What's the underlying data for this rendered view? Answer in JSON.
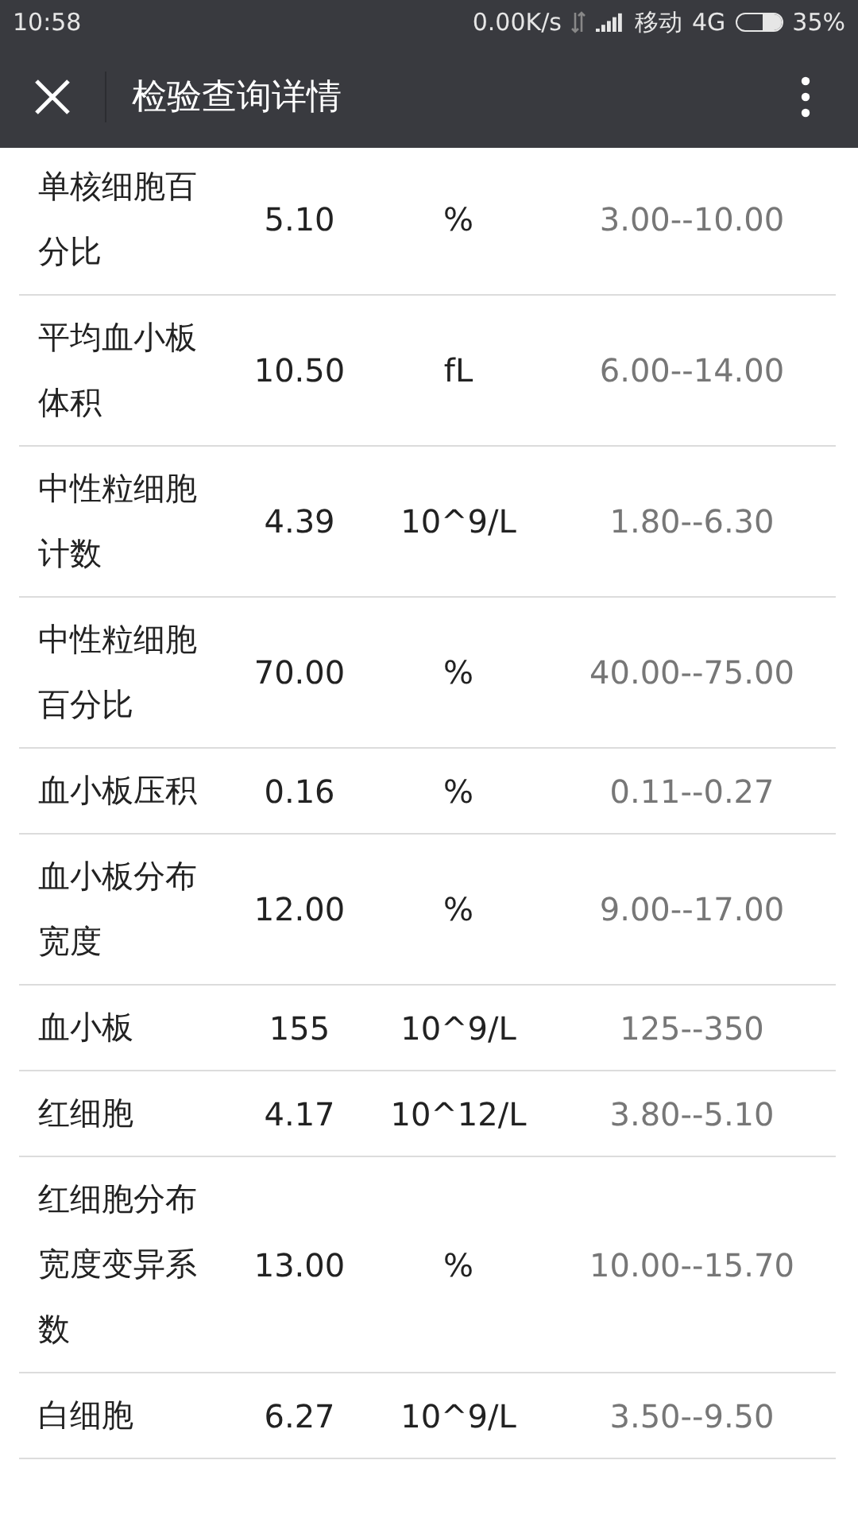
{
  "status_bar": {
    "time": "10:58",
    "speed": "0.00K/s",
    "carrier": "移动",
    "network": "4G",
    "battery": "35%"
  },
  "nav": {
    "title": "检验查询详情"
  },
  "rows": [
    {
      "name": "单核细胞百分比",
      "value": "5.10",
      "unit": "%",
      "range": "3.00--10.00"
    },
    {
      "name": "平均血小板体积",
      "value": "10.50",
      "unit": "fL",
      "range": "6.00--14.00"
    },
    {
      "name": "中性粒细胞计数",
      "value": "4.39",
      "unit": "10^9/L",
      "range": "1.80--6.30"
    },
    {
      "name": "中性粒细胞百分比",
      "value": "70.00",
      "unit": "%",
      "range": "40.00--75.00"
    },
    {
      "name": "血小板压积",
      "value": "0.16",
      "unit": "%",
      "range": "0.11--0.27"
    },
    {
      "name": "血小板分布宽度",
      "value": "12.00",
      "unit": "%",
      "range": "9.00--17.00"
    },
    {
      "name": "血小板",
      "value": "155",
      "unit": "10^9/L",
      "range": "125--350"
    },
    {
      "name": "红细胞",
      "value": "4.17",
      "unit": "10^12/L",
      "range": "3.80--5.10"
    },
    {
      "name": "红细胞分布宽度变异系数",
      "value": "13.00",
      "unit": "%",
      "range": "10.00--15.70"
    },
    {
      "name": "白细胞",
      "value": "6.27",
      "unit": "10^9/L",
      "range": "3.50--9.50"
    }
  ]
}
